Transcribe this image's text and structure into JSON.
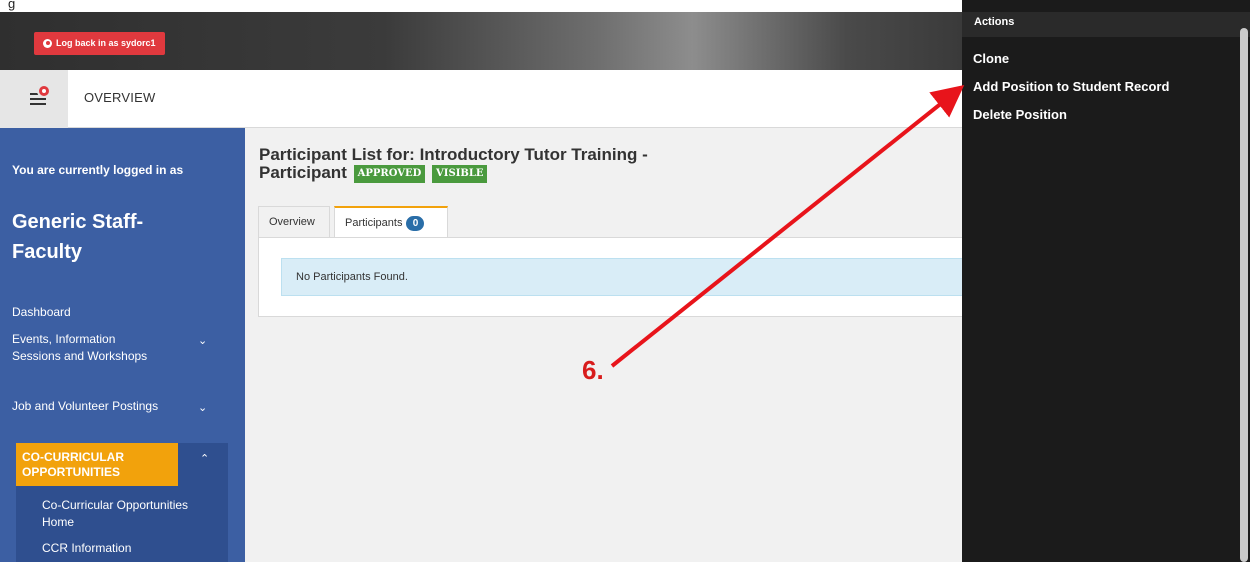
{
  "top_strip": {
    "text_fragment": "g"
  },
  "topbar": {
    "login_back_label": "Log back in as sydorc1"
  },
  "header": {
    "overview_label": "OVERVIEW"
  },
  "sidebar": {
    "logged_in_text": "You are currently logged in as",
    "user_name": "Generic Staff-Faculty",
    "items": [
      {
        "label": "Dashboard"
      },
      {
        "label": "Events, Information Sessions and Workshops"
      },
      {
        "label": "Job and Volunteer Postings"
      },
      {
        "label": "CO-CURRICULAR OPPORTUNITIES"
      }
    ],
    "sub_items": [
      {
        "label": "Co-Curricular Opportunities Home"
      },
      {
        "label": "CCR Information"
      }
    ]
  },
  "main": {
    "title": "Participant List for: Introductory Tutor Training - Participant",
    "badges": [
      "APPROVED",
      "VISIBLE"
    ],
    "tabs": [
      {
        "label": "Overview"
      },
      {
        "label": "Participants",
        "count": "0"
      }
    ],
    "empty_message": "No Participants Found."
  },
  "actions": {
    "title": "Actions",
    "items": [
      "Clone",
      "Add Position to Student Record",
      "Delete Position"
    ]
  },
  "annotation": {
    "step_label": "6.",
    "color": "#e8141b"
  },
  "colors": {
    "accent_orange": "#f2a20c",
    "sidebar_blue": "#3c5fa3",
    "badge_green": "#4a9a3e",
    "danger_red": "#e0393e"
  }
}
